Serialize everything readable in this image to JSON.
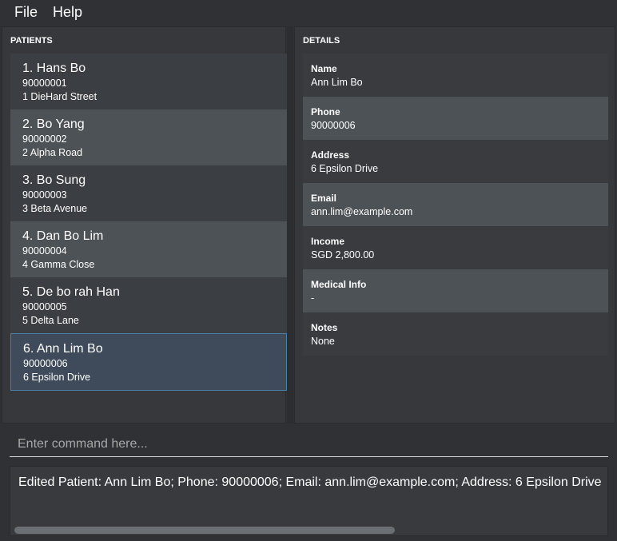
{
  "menu": {
    "file": "File",
    "help": "Help"
  },
  "patients_panel": {
    "title": "PATIENTS",
    "items": [
      {
        "name": "1. Hans Bo",
        "phone": "90000001",
        "address": "1 DieHard Street"
      },
      {
        "name": "2. Bo Yang",
        "phone": "90000002",
        "address": "2 Alpha Road"
      },
      {
        "name": "3. Bo Sung",
        "phone": "90000003",
        "address": "3 Beta Avenue"
      },
      {
        "name": "4. Dan Bo Lim",
        "phone": "90000004",
        "address": "4 Gamma Close"
      },
      {
        "name": "5. De bo rah Han",
        "phone": "90000005",
        "address": "5 Delta Lane"
      },
      {
        "name": "6. Ann Lim Bo",
        "phone": "90000006",
        "address": "6 Epsilon Drive"
      }
    ]
  },
  "details_panel": {
    "title": "DETAILS",
    "fields": [
      {
        "label": "Name",
        "value": "Ann Lim Bo"
      },
      {
        "label": "Phone",
        "value": "90000006"
      },
      {
        "label": "Address",
        "value": "6 Epsilon Drive"
      },
      {
        "label": "Email",
        "value": "ann.lim@example.com"
      },
      {
        "label": "Income",
        "value": "SGD 2,800.00"
      },
      {
        "label": "Medical Info",
        "value": "-"
      },
      {
        "label": "Notes",
        "value": "None"
      }
    ]
  },
  "command": {
    "placeholder": "Enter command here...",
    "value": ""
  },
  "result": {
    "text": "Edited Patient: Ann Lim Bo; Phone: 90000006; Email: ann.lim@example.com; Address: 6 Epsilon Drive"
  },
  "colors": {
    "background": "#2f3134",
    "card": "#3b3e42",
    "card_alt": "#4c5256",
    "selected": "#3f4b5b",
    "selected_border": "#4a7ea3"
  }
}
